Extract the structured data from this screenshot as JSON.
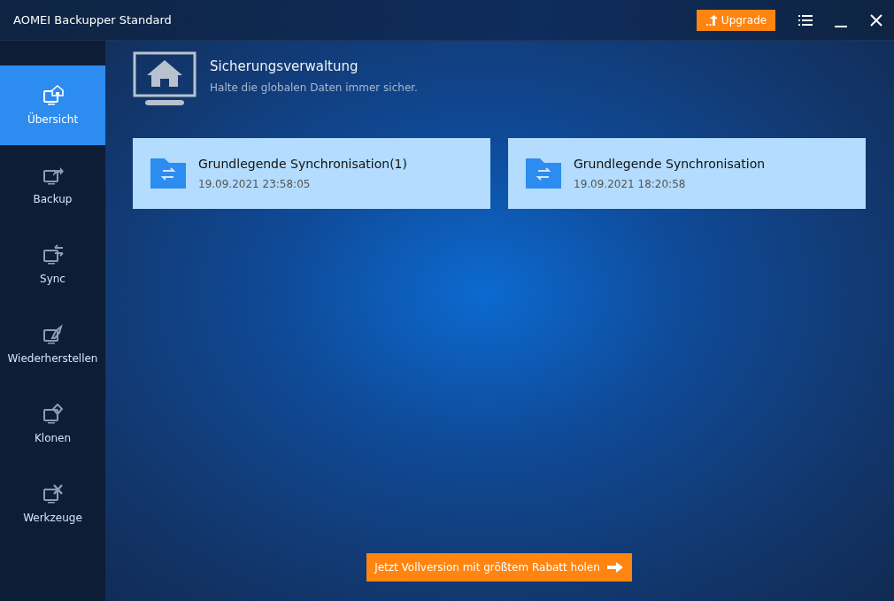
{
  "window": {
    "title": "AOMEI Backupper Standard",
    "upgrade_button": "Upgrade"
  },
  "sidebar": {
    "items": [
      {
        "label": "Übersicht",
        "selected": true
      },
      {
        "label": "Backup",
        "selected": false
      },
      {
        "label": "Sync",
        "selected": false
      },
      {
        "label": "Wiederherstellen",
        "selected": false
      },
      {
        "label": "Klonen",
        "selected": false
      },
      {
        "label": "Werkzeuge",
        "selected": false
      }
    ]
  },
  "header": {
    "title": "Sicherungsverwaltung",
    "subtitle": "Halte die globalen Daten immer sicher."
  },
  "tasks": [
    {
      "name": "Grundlegende Synchronisation(1)",
      "time": "19.09.2021 23:58:05"
    },
    {
      "name": "Grundlegende Synchronisation",
      "time": "19.09.2021 18:20:58"
    }
  ],
  "promo_button": "Jetzt Vollversion mit größtem Rabatt holen"
}
